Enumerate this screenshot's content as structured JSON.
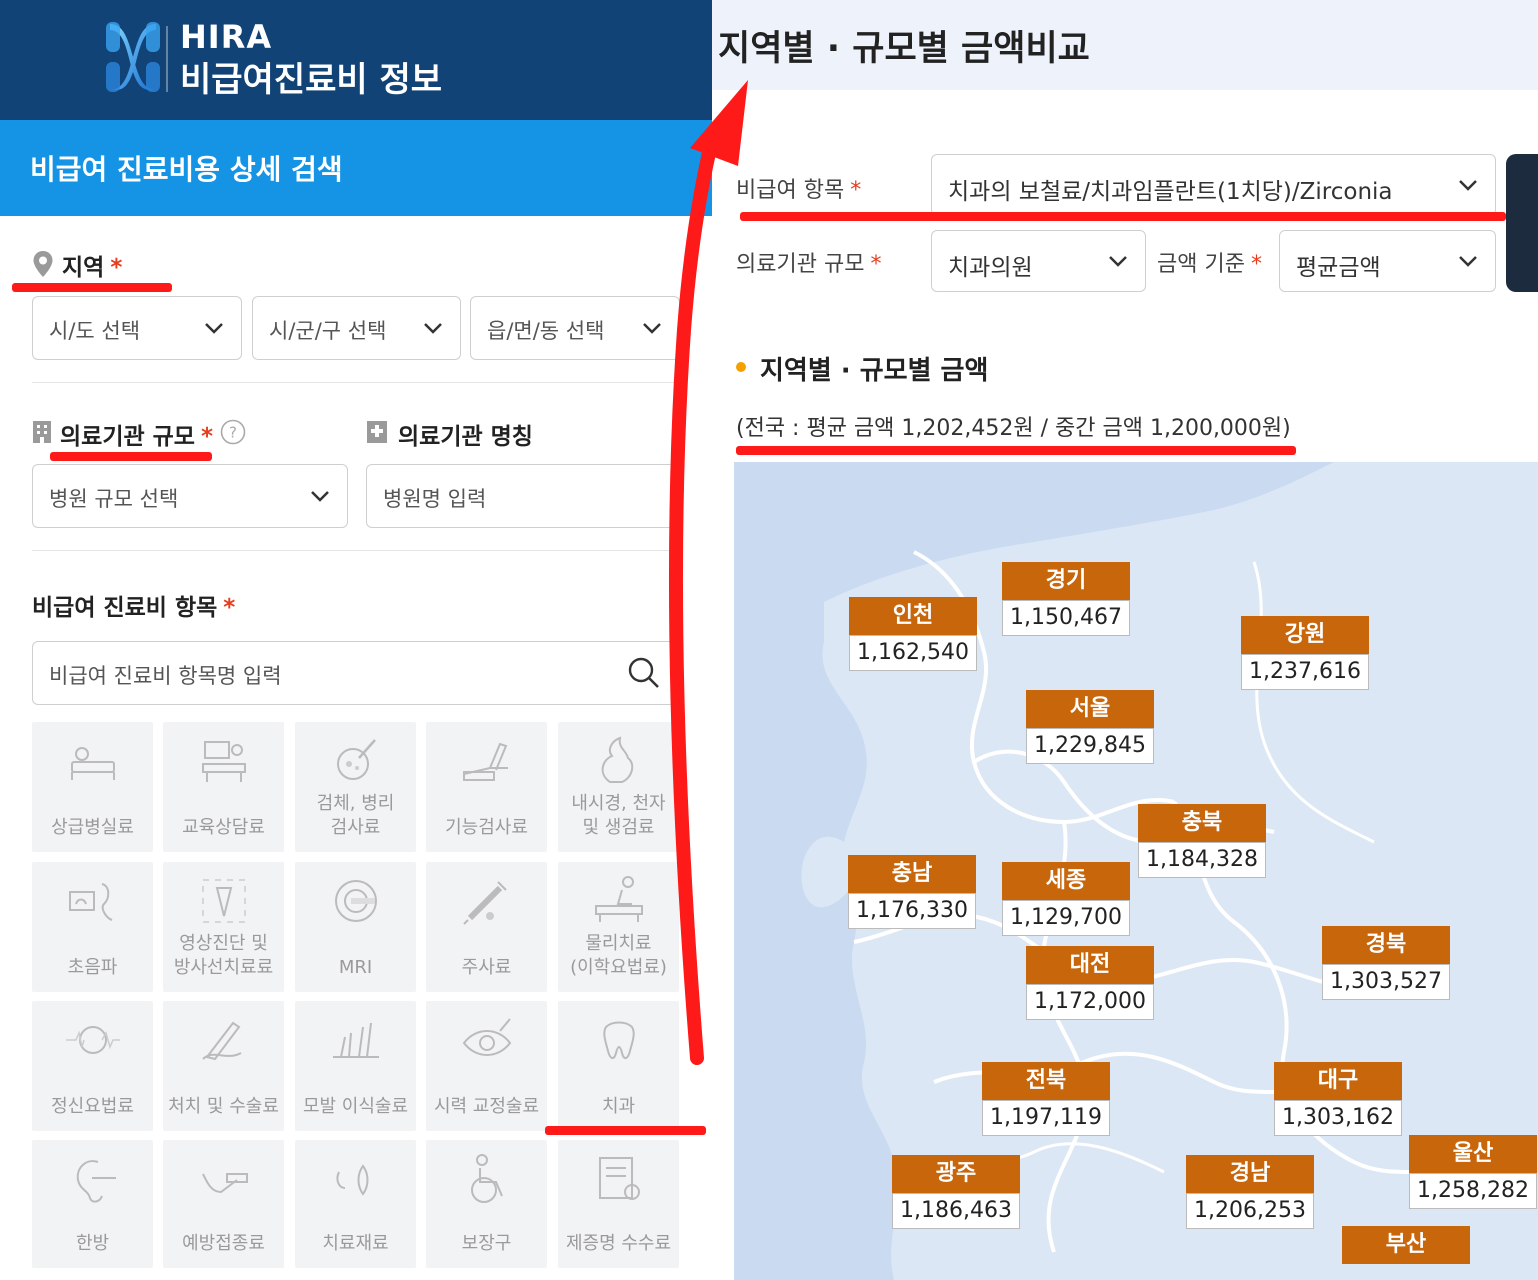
{
  "header": {
    "logo_text": "HIRA",
    "logo_subtitle": "비급여진료비 정보"
  },
  "search_bar_title": "비급여 진료비용 상세 검색",
  "region": {
    "label": "지역",
    "required": "*",
    "selects": [
      "시/도 선택",
      "시/군/구 선택",
      "읍/면/동 선택"
    ]
  },
  "institution_scale": {
    "label": "의료기관 규모",
    "required": "*",
    "select": "병원 규모 선택"
  },
  "institution_name": {
    "label": "의료기관 명칭",
    "placeholder": "병원명 입력"
  },
  "items": {
    "label": "비급여 진료비 항목",
    "required": "*",
    "search_placeholder": "비급여 진료비 항목명 입력",
    "tiles": [
      [
        "상급병실료"
      ],
      [
        "교육상담료"
      ],
      [
        "검체, 병리",
        "검사료"
      ],
      [
        "기능검사료"
      ],
      [
        "내시경, 천자",
        "및 생검료"
      ],
      [
        "초음파"
      ],
      [
        "영상진단 및",
        "방사선치료료"
      ],
      [
        "MRI"
      ],
      [
        "주사료"
      ],
      [
        "물리치료",
        "(이학요법료)"
      ],
      [
        "정신요법료"
      ],
      [
        "처치 및 수술료"
      ],
      [
        "모발 이식술료"
      ],
      [
        "시력 교정술료"
      ],
      [
        "치과"
      ],
      [
        "한방"
      ],
      [
        "예방접종료"
      ],
      [
        "치료재료"
      ],
      [
        "보장구"
      ],
      [
        "제증명 수수료"
      ]
    ],
    "tile_icons": [
      "bed-icon",
      "counseling-icon",
      "microscope-icon",
      "arm-test-icon",
      "endoscope-icon",
      "ultrasound-icon",
      "radiation-icon",
      "mri-icon",
      "syringe-icon",
      "physiotherapy-icon",
      "brain-icon",
      "surgery-icon",
      "hair-transplant-icon",
      "eye-icon",
      "tooth-icon",
      "ear-acupuncture-icon",
      "vaccine-icon",
      "implant-icon",
      "wheelchair-icon",
      "certificate-icon"
    ]
  },
  "right": {
    "title": "지역별 · 규모별 금액비교",
    "item_label": "비급여 항목",
    "item_required": "*",
    "item_value": "치과의 보철료/치과임플란트(1치당)/Zirconia",
    "scale_label": "의료기관 규모",
    "scale_required": "*",
    "scale_value": "치과의원",
    "basis_label": "금액 기준",
    "basis_required": "*",
    "basis_value": "평균금액",
    "section_title": "지역별 · 규모별 금액",
    "national_summary": "(전국 : 평균 금액 1,202,452원 / 중간 금액 1,200,000원)"
  },
  "map_regions": [
    {
      "name": "경기",
      "value": "1,150,467"
    },
    {
      "name": "인천",
      "value": "1,162,540"
    },
    {
      "name": "강원",
      "value": "1,237,616"
    },
    {
      "name": "서울",
      "value": "1,229,845"
    },
    {
      "name": "충북",
      "value": "1,184,328"
    },
    {
      "name": "충남",
      "value": "1,176,330"
    },
    {
      "name": "세종",
      "value": "1,129,700"
    },
    {
      "name": "경북",
      "value": "1,303,527"
    },
    {
      "name": "대전",
      "value": "1,172,000"
    },
    {
      "name": "전북",
      "value": "1,197,119"
    },
    {
      "name": "대구",
      "value": "1,303,162"
    },
    {
      "name": "울산",
      "value": "1,258,282"
    },
    {
      "name": "광주",
      "value": "1,186,463"
    },
    {
      "name": "경남",
      "value": "1,206,253"
    },
    {
      "name": "부산",
      "value": ""
    }
  ],
  "colors": {
    "navy": "#124377",
    "blue": "#1593e5",
    "region_tag": "#c8660c",
    "map_land": "#dce7f5",
    "map_bg": "#c9daf1",
    "red_annotation": "#ff1a1a"
  }
}
